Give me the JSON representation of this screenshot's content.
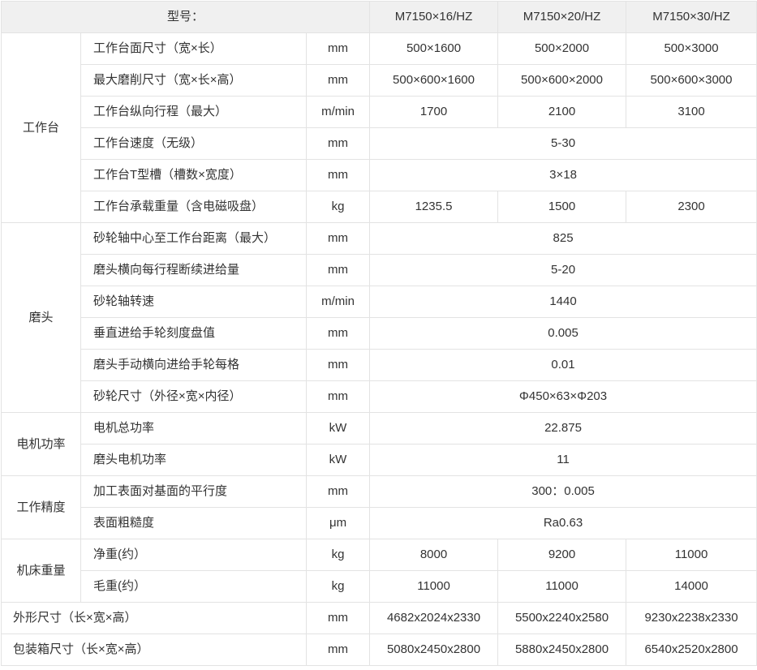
{
  "header": {
    "model_label": "型号：",
    "models": [
      "M7150×16/HZ",
      "M7150×20/HZ",
      "M7150×30/HZ"
    ]
  },
  "groups": {
    "table": "工作台",
    "head": "磨头",
    "power": "电机功率",
    "precision": "工作精度",
    "weight": "机床重量"
  },
  "rows": [
    {
      "label": "工作台面尺寸（宽×长）",
      "unit": "mm",
      "values": [
        "500×1600",
        "500×2000",
        "500×3000"
      ]
    },
    {
      "label": "最大磨削尺寸（宽×长×高）",
      "unit": "mm",
      "values": [
        "500×600×1600",
        "500×600×2000",
        "500×600×3000"
      ]
    },
    {
      "label": "工作台纵向行程（最大）",
      "unit": "m/min",
      "values": [
        "1700",
        "2100",
        "3100"
      ]
    },
    {
      "label": "工作台速度（无级）",
      "unit": "mm",
      "value": "5-30"
    },
    {
      "label": "工作台T型槽（槽数×宽度）",
      "unit": "mm",
      "value": "3×18"
    },
    {
      "label": "工作台承载重量（含电磁吸盘）",
      "unit": "kg",
      "values": [
        "1235.5",
        "1500",
        "2300"
      ]
    },
    {
      "label": "砂轮轴中心至工作台距离（最大）",
      "unit": "mm",
      "value": "825"
    },
    {
      "label": "磨头横向每行程断续进给量",
      "unit": "mm",
      "value": "5-20"
    },
    {
      "label": "砂轮轴转速",
      "unit": "m/min",
      "value": "1440"
    },
    {
      "label": "垂直进给手轮刻度盘值",
      "unit": "mm",
      "value": "0.005"
    },
    {
      "label": "磨头手动横向进给手轮每格",
      "unit": "mm",
      "value": "0.01"
    },
    {
      "label": "砂轮尺寸（外径×宽×内径）",
      "unit": "mm",
      "value": "Φ450×63×Φ203"
    },
    {
      "label": "电机总功率",
      "unit": "kW",
      "value": "22.875"
    },
    {
      "label": "磨头电机功率",
      "unit": "kW",
      "value": "11"
    },
    {
      "label": "加工表面对基面的平行度",
      "unit": "mm",
      "value": "300：0.005"
    },
    {
      "label": "表面粗糙度",
      "unit": "μm",
      "value": "Ra0.63"
    },
    {
      "label": "净重(约）",
      "unit": "kg",
      "values": [
        "8000",
        "9200",
        "11000"
      ]
    },
    {
      "label": "毛重(约）",
      "unit": "kg",
      "values": [
        "11000",
        "11000",
        "14000"
      ]
    },
    {
      "label": "外形尺寸（长×宽×高）",
      "unit": "mm",
      "values": [
        "4682x2024x2330",
        "5500x2240x2580",
        "9230x2238x2330"
      ]
    },
    {
      "label": "包装箱尺寸（长×宽×高）",
      "unit": "mm",
      "values": [
        "5080x2450x2800",
        "5880x2450x2800",
        "6540x2520x2800"
      ]
    }
  ]
}
